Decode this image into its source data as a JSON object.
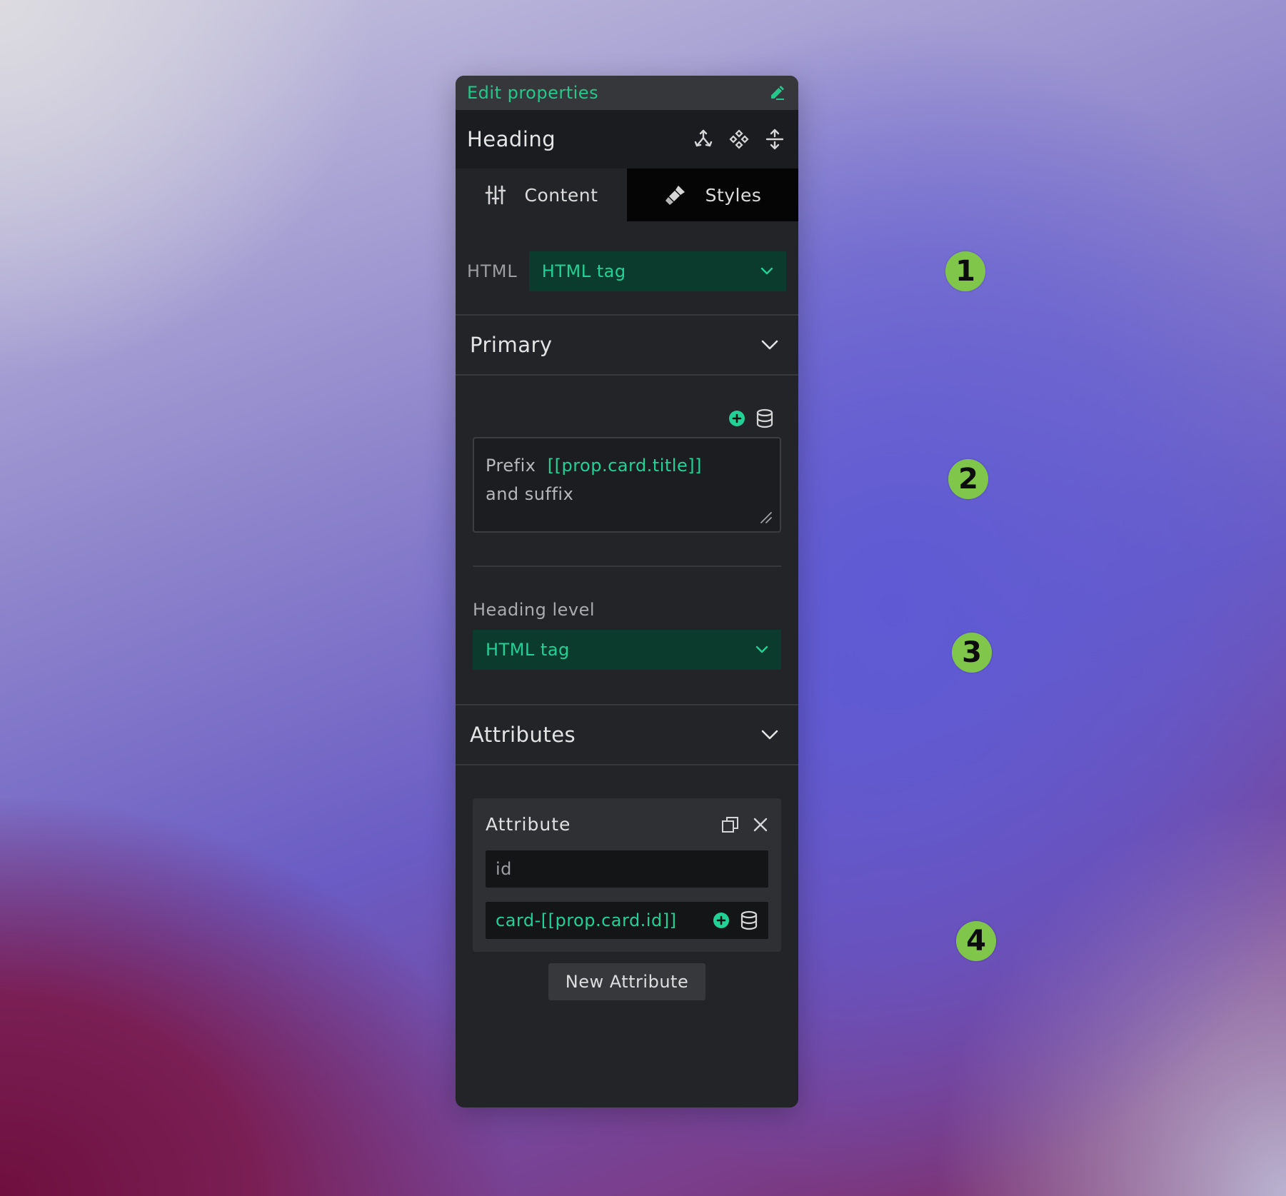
{
  "panel": {
    "title": "Edit properties",
    "element_name": "Heading",
    "tabs": [
      {
        "label": "Content",
        "icon": "sliders-icon",
        "active": true
      },
      {
        "label": "Styles",
        "icon": "paintbrush-icon",
        "active": false
      }
    ],
    "html_row": {
      "label": "HTML",
      "select_value": "HTML tag"
    },
    "sections": {
      "primary": {
        "title": "Primary",
        "text_prefix": "Prefix",
        "text_token": "[[prop.card.title]]",
        "text_suffix": "and suffix",
        "heading_level_label": "Heading level",
        "heading_level_value": "HTML tag"
      },
      "attributes": {
        "title": "Attributes",
        "card_title": "Attribute",
        "key_value": "id",
        "value_value": "card-[[prop.card.id]]",
        "new_button": "New Attribute"
      }
    }
  },
  "badges": [
    "1",
    "2",
    "3",
    "4"
  ],
  "colors": {
    "accent": "#22d196",
    "badge": "#7fc64a",
    "panel": "#232427"
  }
}
